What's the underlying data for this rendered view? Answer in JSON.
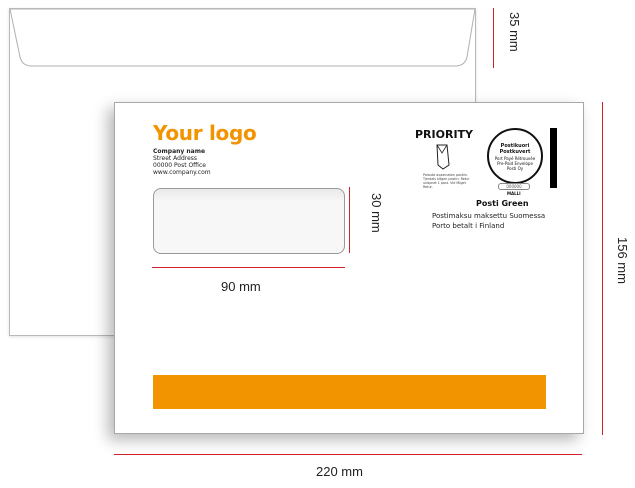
{
  "front": {
    "logo_text": "Your logo",
    "company_name": "Company name",
    "street": "Street Address",
    "post_office": "00000 Post Office",
    "website": "www.company.com",
    "priority": "PRIORITY",
    "priority_note": "Palauta avaamaton postiin. Tjerdals hågen postin. Retur unöpnet 1 post. Vid fälget Retur.",
    "stamp_line1": "Postikuori",
    "stamp_line2": "Postkuvert",
    "stamp_line3": "Port Payé Rétrouvée",
    "stamp_line4": "Pre-Paid Envelope",
    "stamp_line5": "Posti Oy",
    "stamp_code": "000000",
    "malli": "MALLI",
    "posti_green": "Posti Green",
    "posti_line1": "Postimaksu maksettu Suomessa",
    "posti_line2": "Porto betalt i Finland"
  },
  "dimensions": {
    "flap_height": "35 mm",
    "total_height": "156 mm",
    "window_height": "30 mm",
    "window_width": "90 mm",
    "total_width": "220 mm"
  },
  "colors": {
    "brand_orange": "#f29400",
    "dimension_red": "#d4202a"
  }
}
